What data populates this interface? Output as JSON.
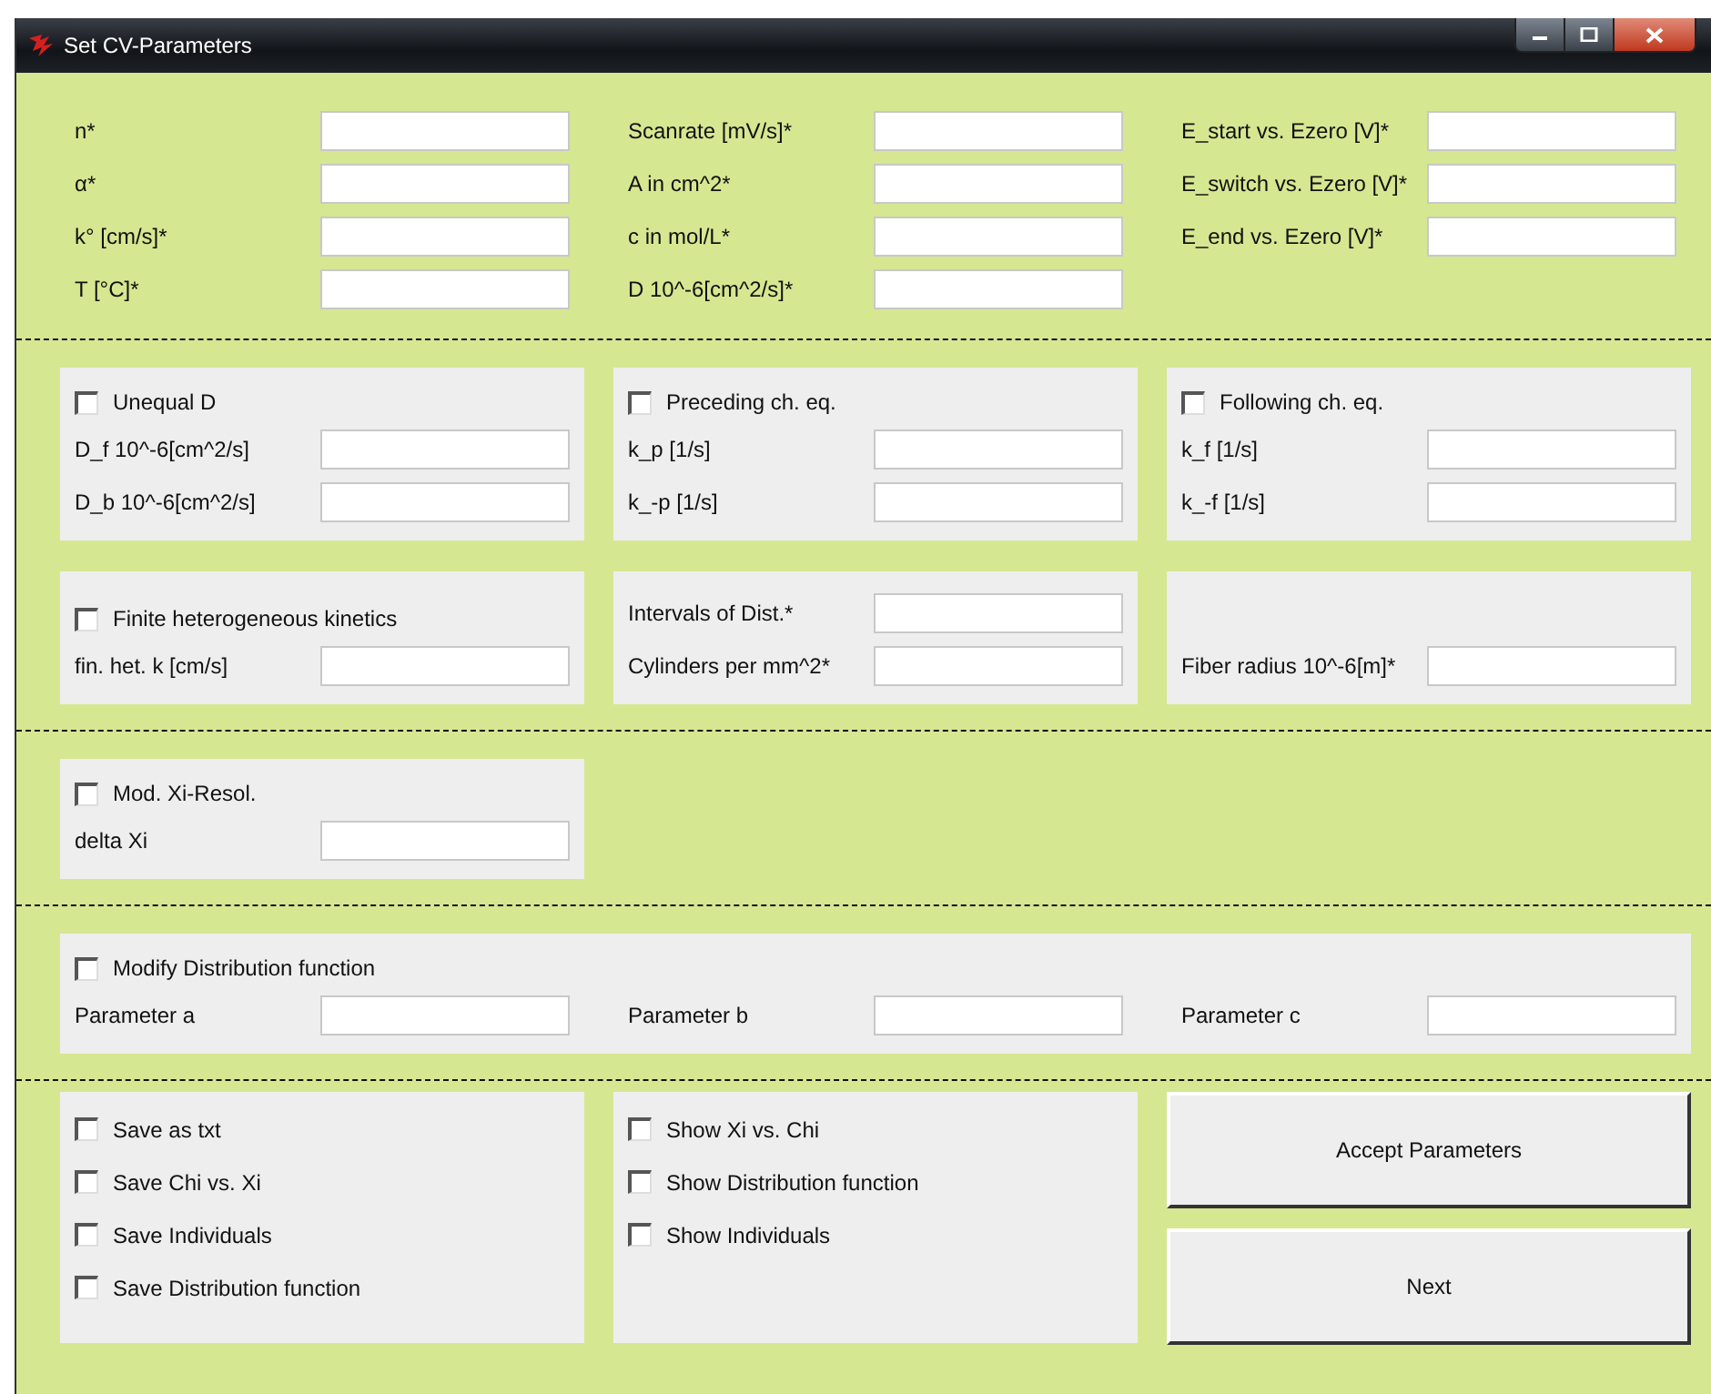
{
  "window": {
    "title": "Set CV-Parameters"
  },
  "main_fields": [
    {
      "fields": [
        {
          "label": "n*"
        },
        {
          "label": "α*"
        },
        {
          "label": "k° [cm/s]*"
        },
        {
          "label": "T [°C]*"
        }
      ]
    },
    {
      "fields": [
        {
          "label": "Scanrate [mV/s]*"
        },
        {
          "label": "A in cm^2*"
        },
        {
          "label": "c in mol/L*"
        },
        {
          "label": "D 10^-6[cm^2/s]*"
        }
      ]
    },
    {
      "fields": [
        {
          "label": "E_start vs. Ezero [V]*"
        },
        {
          "label": "E_switch vs. Ezero [V]*"
        },
        {
          "label": "E_end vs. Ezero [V]*"
        }
      ]
    }
  ],
  "panel_sections": [
    {
      "rows": [
        [
          {
            "kind": "stack",
            "checkbox": {
              "label": "Unequal D",
              "checked": false
            },
            "fields": [
              {
                "label": "D_f 10^-6[cm^2/s]"
              },
              {
                "label": "D_b 10^-6[cm^2/s]"
              }
            ]
          },
          {
            "kind": "stack",
            "checkbox": {
              "label": "Preceding ch. eq.",
              "checked": false
            },
            "fields": [
              {
                "label": "k_p [1/s]"
              },
              {
                "label": "k_-p [1/s]"
              }
            ]
          },
          {
            "kind": "stack",
            "checkbox": {
              "label": "Following ch. eq.",
              "checked": false
            },
            "fields": [
              {
                "label": "k_f [1/s]"
              },
              {
                "label": "k_-f [1/s]"
              }
            ]
          }
        ],
        [
          {
            "kind": "stack",
            "checkbox": {
              "label": "Finite heterogeneous kinetics",
              "checked": false
            },
            "fields": [
              {
                "label": "fin. het. k [cm/s]"
              }
            ]
          },
          {
            "kind": "stack",
            "fields": [
              {
                "label": "Intervals of Dist.*"
              },
              {
                "label": "Cylinders per mm^2*"
              }
            ]
          },
          {
            "kind": "stack",
            "fields": [
              {
                "label": "Fiber radius 10^-6[m]*"
              }
            ]
          }
        ]
      ]
    },
    {
      "rows": [
        [
          {
            "kind": "stack",
            "checkbox": {
              "label": "Mod. Xi-Resol.",
              "checked": false
            },
            "fields": [
              {
                "label": "delta Xi"
              }
            ]
          }
        ]
      ]
    },
    {
      "rows": [
        [
          {
            "kind": "inline",
            "checkbox": {
              "label": "Modify Distribution function",
              "checked": false
            },
            "fields": [
              {
                "label": "Parameter a"
              },
              {
                "label": "Parameter b"
              },
              {
                "label": "Parameter c"
              }
            ]
          }
        ]
      ]
    }
  ],
  "option_panels": [
    {
      "options": [
        {
          "label": "Save as txt",
          "checked": false
        },
        {
          "label": "Save Chi vs. Xi",
          "checked": false
        },
        {
          "label": "Save Individuals",
          "checked": false
        },
        {
          "label": "Save Distribution function",
          "checked": false
        }
      ]
    },
    {
      "options": [
        {
          "label": "Show Xi vs. Chi",
          "checked": false
        },
        {
          "label": "Show Distribution function",
          "checked": false
        },
        {
          "label": "Show Individuals",
          "checked": false
        }
      ]
    }
  ],
  "buttons": [
    "Accept Parameters",
    "Next"
  ]
}
